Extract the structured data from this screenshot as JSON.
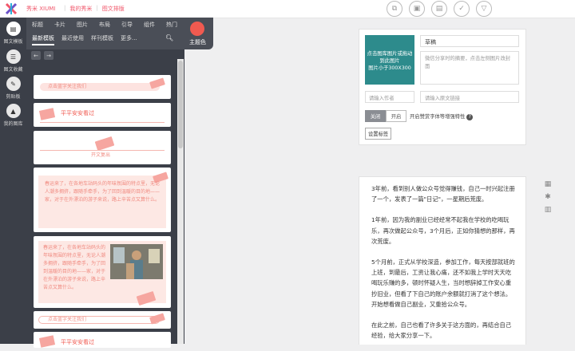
{
  "brand": {
    "name": "秀米 XIUMI"
  },
  "top_nav": [
    {
      "label": "我的秀米"
    },
    {
      "label": "图文排版"
    }
  ],
  "top_tools": [
    {
      "name": "copy-icon",
      "glyph": "⧉"
    },
    {
      "name": "save-as-icon",
      "glyph": "▣"
    },
    {
      "name": "save-icon",
      "glyph": "▤"
    },
    {
      "name": "check-icon",
      "glyph": "✓"
    },
    {
      "name": "more-icon",
      "glyph": "▽"
    }
  ],
  "left_bar": [
    {
      "label": "图文模板",
      "glyph": "▤"
    },
    {
      "label": "图文收藏",
      "glyph": "☰"
    },
    {
      "label": "剪贴板",
      "glyph": "✎"
    },
    {
      "label": "我的图库",
      "glyph": "▲"
    }
  ],
  "categories": [
    "标题",
    "卡片",
    "图片",
    "布局",
    "引导",
    "组件",
    "热门"
  ],
  "sub_tabs": [
    "最新模板",
    "最近使用",
    "样刊模板",
    "更多..."
  ],
  "theme_color": {
    "label": "主题色",
    "value": "#f05a50"
  },
  "templates": {
    "t1_label": "点击蓝字关注我们",
    "t2_title": "平平安安看过",
    "t3_label": "开文复出",
    "t4_text": "春运来了，在各地车站码头的年味氛围的特点里，无论人潮多拥挤，跟随手牵手，为了回到温暖的目的地——家，对于在外漂泊的游子来说，路上辛苦点又算什么。",
    "t5_text": "春运来了，在各地车站码头的年味氛围的特点里，无论人潮多拥挤，跟随手牵手，为了回到温暖的目的地——家，对于在外漂泊的游子来说，路上辛苦点又算什么。",
    "t6_label": "点击蓝字关注我们",
    "t7_title": "平平安安看过"
  },
  "article_meta": {
    "cover_text": "点击图库图片或拖动到此图片\n图片小于300X300",
    "title_value": "草稿",
    "digest_placeholder": "微信分享时的摘要，点击左侧图片改封面",
    "author_placeholder": "请输入作者",
    "url_placeholder": "请输入原文链接",
    "toggle_on": "关闭",
    "toggle_off": "开启",
    "toggle_note": "开启赞赏字体等增强特性",
    "tags_button": "设置标签"
  },
  "article_body": [
    "3年前，看到别人做公众号觉得赚钱，自己一时兴起注册了一个，发表了一篇\"日记\"，一星期后荒废。",
    "1年前，因为我的副业已经经常不起我在学校的吃喝玩乐，再次做起公众号，3个月后，正如你猜想的那样，再次荒废。",
    "5个月前，正式从学校深造，参加工作，每天按部就班的上班，到最后，工资让我心痛，还不如我上学时天天吃喝玩乐赚的多，顿时怀疑人生，当时想辞掉工作安心重抄旧业，但看了下自己的账户余额就打消了这个想法。开始想看做自己副业，又重拾公众号。",
    "在此之前，自己也看了许多关于这方面的，再结合自己经验，给大家分享一下。"
  ],
  "right_tools": [
    {
      "name": "grid-icon",
      "glyph": "▦"
    },
    {
      "name": "settings-icon",
      "glyph": "✱"
    },
    {
      "name": "stats-icon",
      "glyph": "▥"
    }
  ]
}
